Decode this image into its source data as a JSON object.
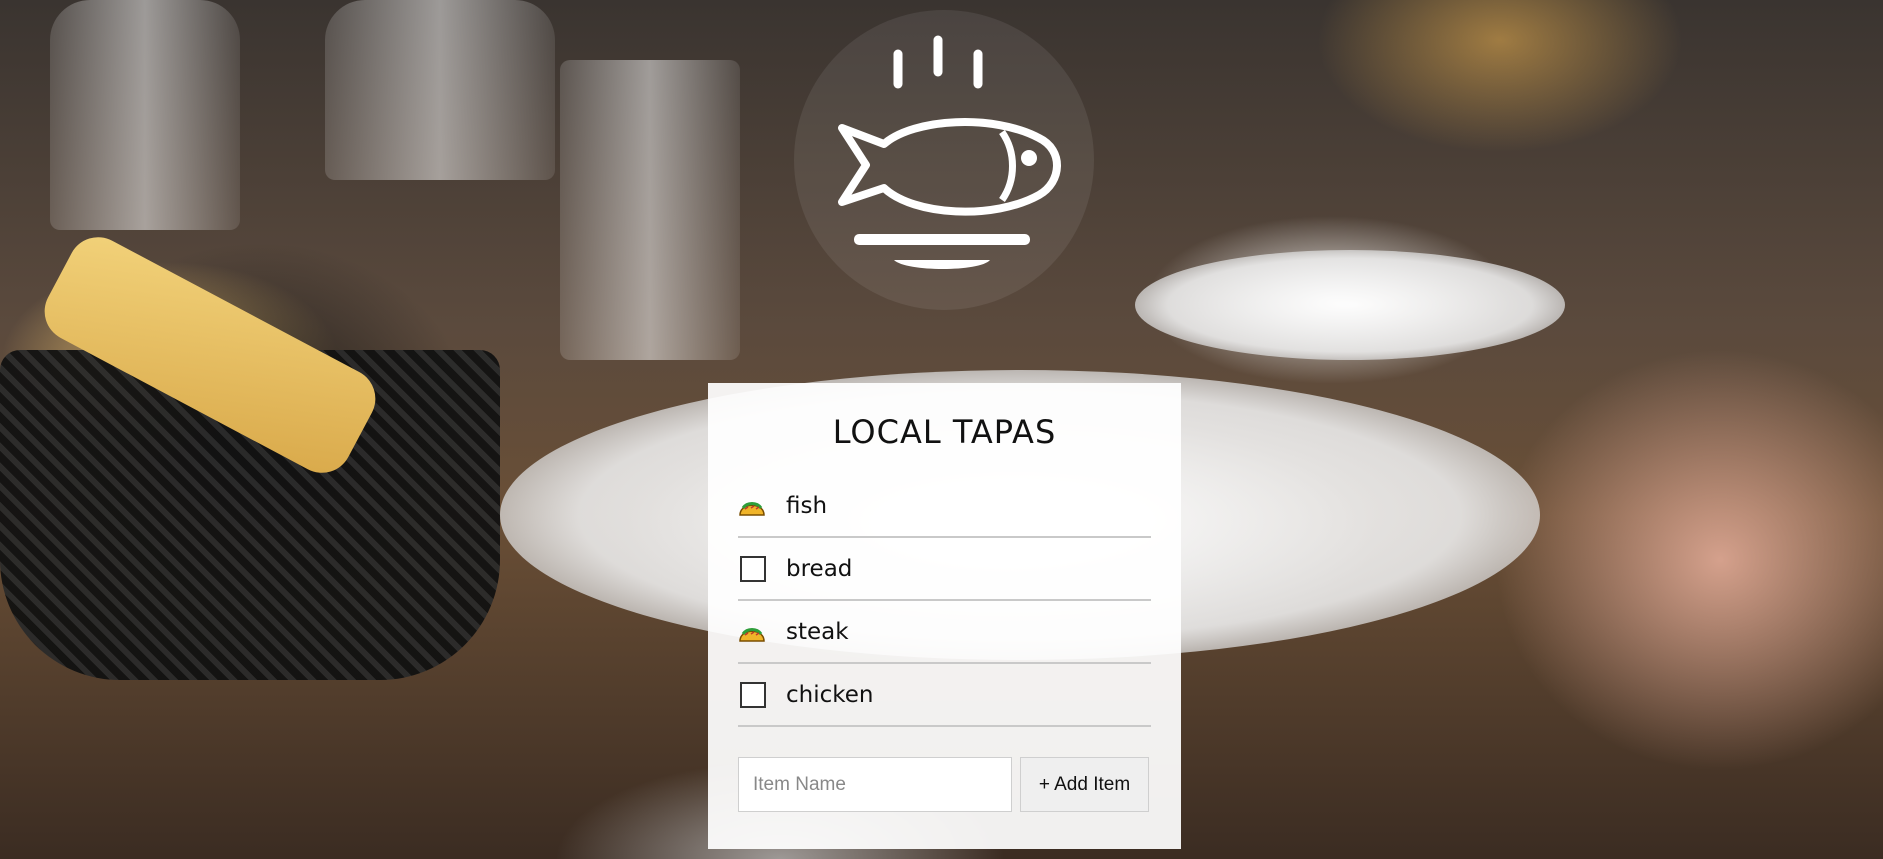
{
  "app": {
    "title": "LOCAL TAPAS",
    "logo_icon": "fish-on-plate-icon"
  },
  "items": [
    {
      "label": "fish",
      "checked": true,
      "icon": "taco-icon"
    },
    {
      "label": "bread",
      "checked": false,
      "icon": "checkbox-icon"
    },
    {
      "label": "steak",
      "checked": true,
      "icon": "taco-icon"
    },
    {
      "label": "chicken",
      "checked": false,
      "icon": "checkbox-icon"
    }
  ],
  "form": {
    "input_placeholder": "Item Name",
    "input_value": "",
    "add_button_label": "+ Add Item"
  },
  "colors": {
    "card_background": "#ffffff",
    "text": "#111111",
    "divider": "#c9c9c9"
  }
}
